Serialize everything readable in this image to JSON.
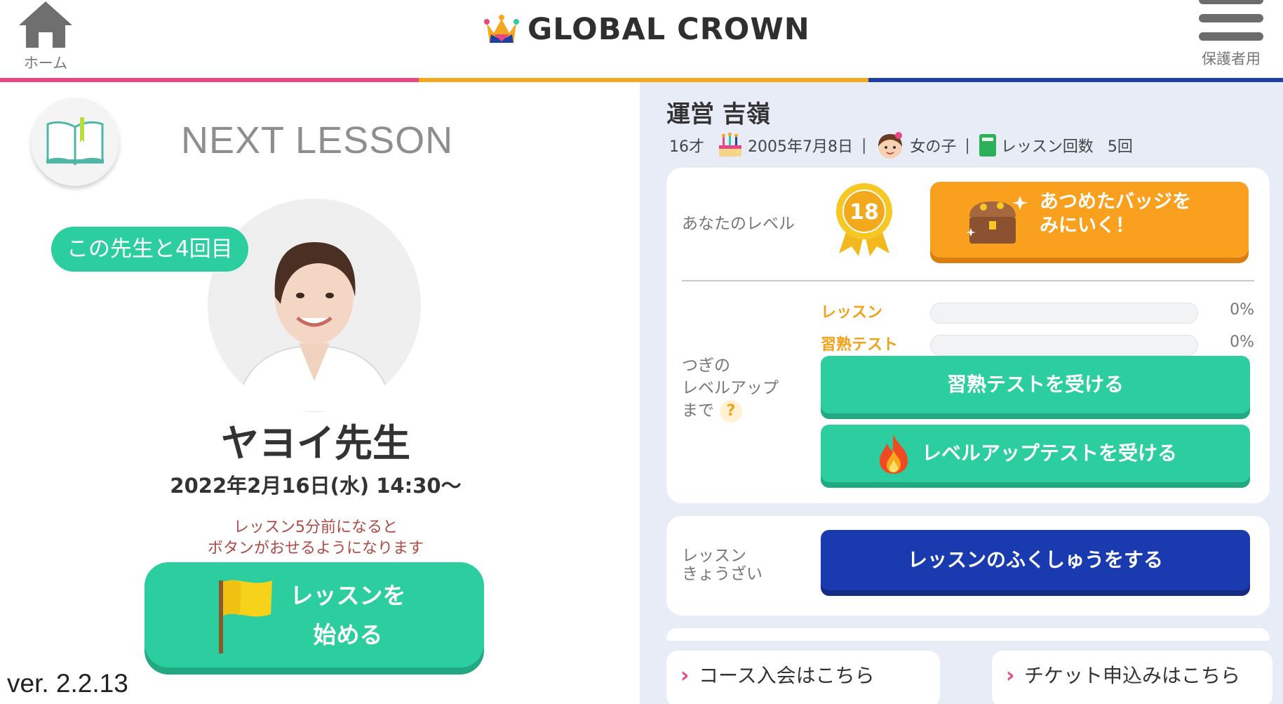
{
  "header": {
    "home_label": "ホーム",
    "logo_text": "GLOBAL CROWN",
    "menu_label": "保護者用",
    "stripe_colors": [
      "#e94783",
      "#f5a81e",
      "#1f3fa3"
    ]
  },
  "next_lesson": {
    "heading": "NEXT LESSON",
    "lesson_count_badge": "この先生と4回目",
    "teacher_name": "ヤヨイ先生",
    "date": "2022年2月16日(水) 14:30〜",
    "notice_line1": "レッスン5分前になると",
    "notice_line2": "ボタンがおせるようになります",
    "start_label_line1": "レッスンを",
    "start_label_line2": "始める"
  },
  "version": "ver. 2.2.13",
  "student": {
    "name": "運営 吉嶺",
    "age": "16才",
    "birthday": "2005年7月8日",
    "gender": "女の子",
    "lesson_count_label": "レッスン回数",
    "lesson_count": "5回",
    "separator": "|"
  },
  "level_card": {
    "level_label": "あなたのレベル",
    "level": "18",
    "badge_button_line1": "あつめたバッジを",
    "badge_button_line2": "みにいく！",
    "progress": [
      {
        "label": "レッスン",
        "percent_text": "0%",
        "value": 0
      },
      {
        "label": "習熟テスト",
        "percent_text": "0%",
        "value": 0
      }
    ],
    "next_level_line1": "つぎの",
    "next_level_line2": "レベルアップ",
    "next_level_line3": "まで",
    "help_mark": "?",
    "mastery_test_button": "習熟テストを受ける",
    "levelup_test_button": "レベルアップテストを受ける"
  },
  "review_card": {
    "label_line1": "レッスン",
    "label_line2": "きょうざい",
    "review_button": "レッスンのふくしゅうをする"
  },
  "footer": {
    "course_link": "コース入会はこちら",
    "ticket_link": "チケット申込みはこちら",
    "chevron": "›"
  },
  "colors": {
    "accent_green": "#2ccd9f",
    "accent_orange": "#f9a01f",
    "accent_blue": "#1a3bb0",
    "pink": "#e94783"
  }
}
